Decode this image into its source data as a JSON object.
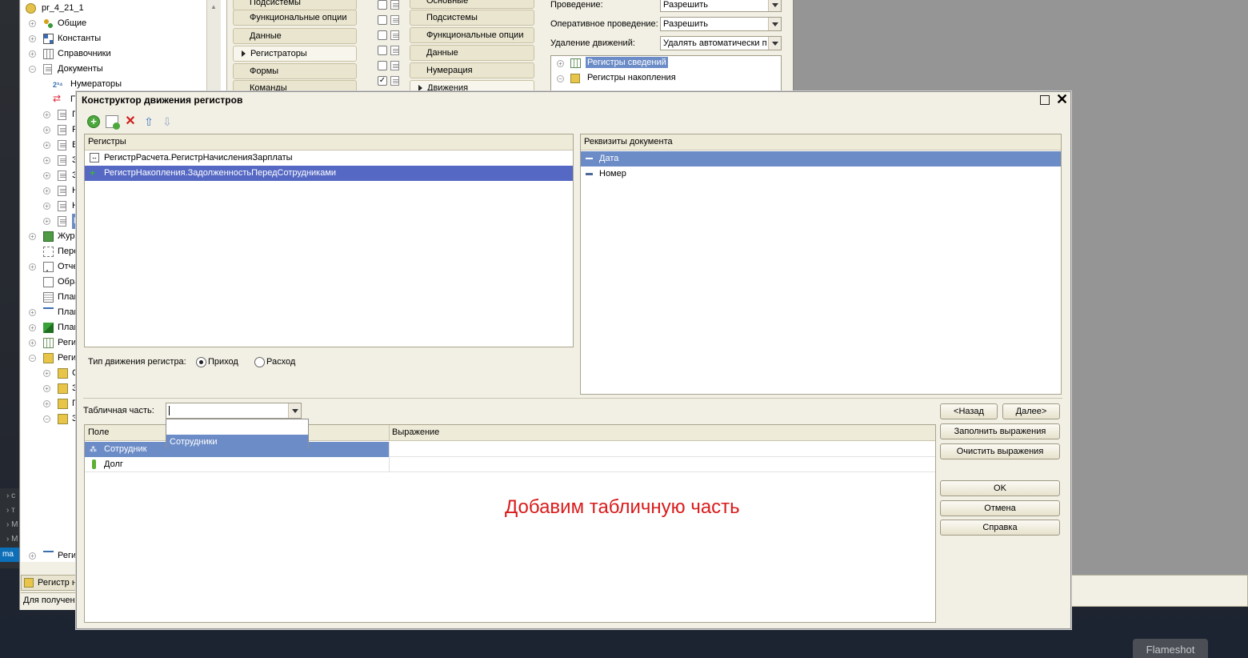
{
  "background_app": {
    "tree": {
      "root_label": "pr_4_21_1",
      "items": [
        {
          "label": "Общие"
        },
        {
          "label": "Константы"
        },
        {
          "label": "Справочники"
        },
        {
          "label": "Документы"
        },
        {
          "label": "Нумераторы"
        },
        {
          "label": "П"
        },
        {
          "label": "Г"
        },
        {
          "label": "Р"
        },
        {
          "label": "В"
        },
        {
          "label": "З"
        },
        {
          "label": "З"
        },
        {
          "label": "Н"
        },
        {
          "label": "Н"
        },
        {
          "label": "Н"
        },
        {
          "label": "Журн"
        },
        {
          "label": "Пере"
        },
        {
          "label": "Отче"
        },
        {
          "label": "Обра"
        },
        {
          "label": "План"
        },
        {
          "label": "План"
        },
        {
          "label": "План"
        },
        {
          "label": "Реги"
        },
        {
          "label": "Реги"
        },
        {
          "label": "С"
        },
        {
          "label": "З"
        },
        {
          "label": "П"
        },
        {
          "label": "З"
        },
        {
          "label": "Реги"
        }
      ]
    },
    "left_nav": [
      "Подсистемы",
      "Функциональные опции",
      "Данные",
      "Регистраторы",
      "Формы",
      "Команды"
    ],
    "mid_nav": [
      "Основные",
      "Подсистемы",
      "Функциональные опции",
      "Данные",
      "Нумерация",
      "Движения"
    ],
    "properties": [
      {
        "label": "Проведение:",
        "value": "Разрешить"
      },
      {
        "label": "Оперативное проведение:",
        "value": "Разрешить"
      },
      {
        "label": "Удаление движений:",
        "value": "Удалять автоматически п"
      }
    ],
    "registers_tree": [
      "Регистры сведений",
      "Регистры накопления"
    ],
    "bottom_tab": "Регистр н",
    "status": "Для получен",
    "left_taskbar": [
      "с",
      "т",
      "М",
      "М",
      "ma"
    ]
  },
  "dialog": {
    "title": "Конструктор движения регистров",
    "registers": {
      "header": "Регистры",
      "rows": [
        "РегистрРасчета.РегистрНачисленияЗарплаты",
        "РегистрНакопления.ЗадолженностьПередСотрудниками"
      ]
    },
    "doc_attrs": {
      "header": "Реквизиты документа",
      "rows": [
        "Дата",
        "Номер"
      ]
    },
    "movement_type": {
      "label": "Тип движения регистра:",
      "options": [
        "Приход",
        "Расход"
      ],
      "selected": "Приход"
    },
    "tabular": {
      "label": "Табличная часть:",
      "value": "",
      "options": [
        "",
        "Сотрудники"
      ],
      "highlighted": "Сотрудники"
    },
    "fields": {
      "col_field": "Поле",
      "col_expr": "Выражение",
      "rows": [
        {
          "field": "Сотрудник",
          "expr": ""
        },
        {
          "field": "Долг",
          "expr": ""
        }
      ]
    },
    "buttons": {
      "back": "<Назад",
      "next": "Далее>",
      "fill": "Заполнить выражения",
      "clear": "Очистить выражения",
      "ok": "OK",
      "cancel": "Отмена",
      "help": "Справка"
    },
    "annotation": "Добавим табличную часть"
  },
  "flameshot": "Flameshot",
  "colors": {
    "selection": "#5568c4",
    "selection_light": "#6c8cc7",
    "annotation": "#d91c1c"
  }
}
